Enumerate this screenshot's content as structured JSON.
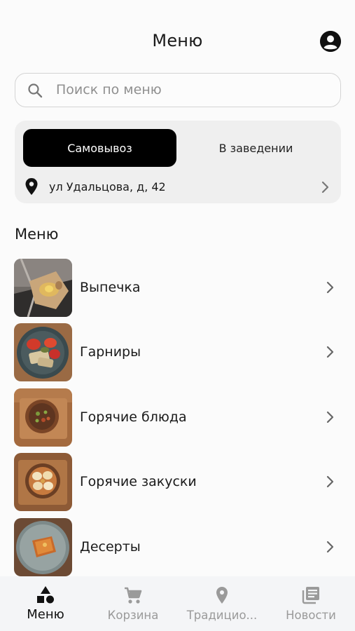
{
  "header": {
    "title": "Меню"
  },
  "search": {
    "placeholder": "Поиск по меню"
  },
  "order_mode": {
    "active_label": "Самовывоз",
    "inactive_label": "В заведении",
    "address": "ул Удальцова, д, 42"
  },
  "section": {
    "title": "Меню"
  },
  "menu_items": [
    {
      "label": "Выпечка"
    },
    {
      "label": "Гарниры"
    },
    {
      "label": "Горячие блюда"
    },
    {
      "label": "Горячие закуски"
    },
    {
      "label": "Десерты"
    }
  ],
  "bottom_nav": [
    {
      "label": "Меню",
      "icon": "shapes-icon",
      "active": true
    },
    {
      "label": "Корзина",
      "icon": "cart-icon",
      "active": false
    },
    {
      "label": "Традицио...",
      "icon": "location-pin-icon",
      "active": false
    },
    {
      "label": "Новости",
      "icon": "news-icon",
      "active": false
    }
  ],
  "colors": {
    "active": "#000000",
    "inactive": "#9a9a9a",
    "card": "#efefef"
  }
}
